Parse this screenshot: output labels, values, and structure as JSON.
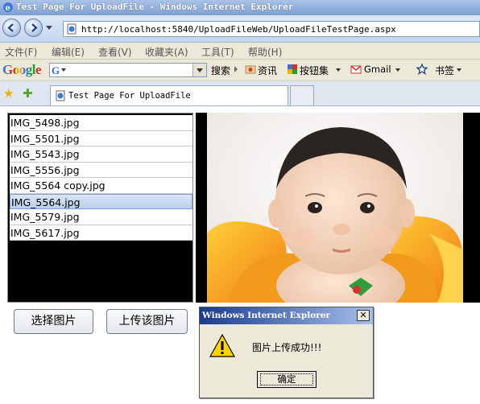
{
  "window": {
    "title": "Test Page For UploadFile - Windows Internet Explorer"
  },
  "address_bar": {
    "url": "http://localhost:5840/UploadFileWeb/UploadFileTestPage.aspx"
  },
  "menu": {
    "items": [
      "文件(F)",
      "编辑(E)",
      "查看(V)",
      "收藏夹(A)",
      "工具(T)",
      "帮助(H)"
    ]
  },
  "google_toolbar": {
    "logo": "Google",
    "search_button": "搜索",
    "news": "资讯",
    "bookmarks_button": "按钮集",
    "gmail": "Gmail",
    "bookmarks": "书签"
  },
  "tab": {
    "label": "Test Page For UploadFile"
  },
  "file_list": {
    "items": [
      "IMG_5498.jpg",
      "IMG_5501.jpg",
      "IMG_5543.jpg",
      "IMG_5556.jpg",
      "IMG_5564 copy.jpg",
      "IMG_5564.jpg",
      "IMG_5579.jpg",
      "IMG_5617.jpg"
    ],
    "selected": "IMG_5564.jpg"
  },
  "buttons": {
    "choose": "选择图片",
    "upload": "上传该图片"
  },
  "dialog": {
    "title": "Windows Internet Explorer",
    "message": "图片上传成功!!!",
    "ok": "确定",
    "close": "✕"
  },
  "colors": {
    "title_bar": "#7f9fd0",
    "selection": "#b8cde8",
    "dialog_title": "#1a3a8f"
  }
}
